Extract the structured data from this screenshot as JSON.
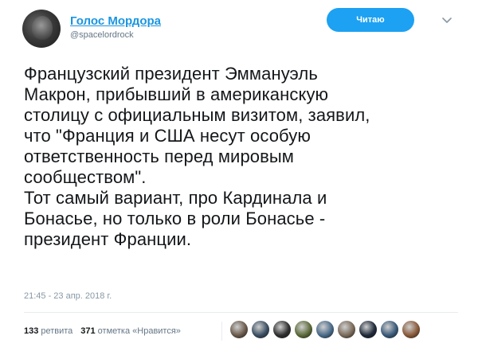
{
  "author": {
    "display_name": "Голос Мордора",
    "handle": "@spacelordrock"
  },
  "follow_button": {
    "label": "Читаю"
  },
  "tweet": {
    "lines": [
      "Французский президент Эммануэль",
      "Макрон, прибывший в американскую",
      "столицу с официальным визитом, заявил,",
      "что \"Франция и США несут особую",
      "ответственность перед мировым",
      "сообществом\".",
      "Тот самый вариант, про Кардинала и",
      "Бонасье, но только в роли Бонасье -",
      "президент Франции."
    ],
    "timestamp": "21:45 - 23 апр. 2018 г."
  },
  "stats": {
    "retweets_count": "133",
    "retweets_label": "ретвита",
    "likes_count": "371",
    "likes_label": "отметка «Нравится»"
  },
  "likers": [
    {
      "color": "#6a5a4a"
    },
    {
      "color": "#3b4f63"
    },
    {
      "color": "#2f2f2f"
    },
    {
      "color": "#5c6b3a"
    },
    {
      "color": "#4a6b8a"
    },
    {
      "color": "#7a6a5a"
    },
    {
      "color": "#1f2a3a"
    },
    {
      "color": "#3a5a7a"
    },
    {
      "color": "#8a5a3a"
    }
  ],
  "colors": {
    "accent": "#1da1f2",
    "link": "#1b95e0",
    "muted": "#657786"
  }
}
